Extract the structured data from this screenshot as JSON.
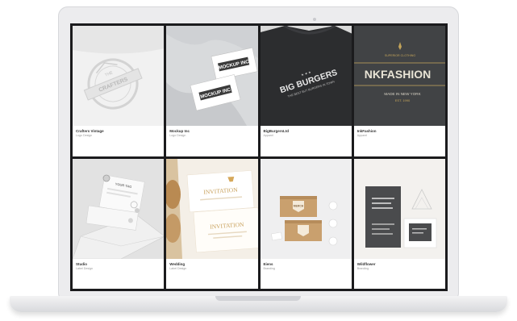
{
  "gallery": {
    "tiles": [
      {
        "title": "Crafters Vintage",
        "subtitle": "Logo Design",
        "art": {
          "seal_top": "THE",
          "seal_text": "CRAFTERS",
          "bg": "#f1f1f1"
        }
      },
      {
        "title": "Mockup Inc",
        "subtitle": "Logo Design",
        "art": {
          "card_text": "MOCKUP INC",
          "bg": "#d8dadc"
        }
      },
      {
        "title": "BigBurgersLtd",
        "subtitle": "Apparel",
        "art": {
          "line1": "BIG BURGERS",
          "line2": "THE BEST BUT BURGERS IN TOWN",
          "bg": "#2c2d2f"
        }
      },
      {
        "title": "InkFashion",
        "subtitle": "Apparel",
        "art": {
          "brand": "NKFASHION",
          "tag": "SUPERIOR CLOTHING",
          "made": "MADE IN NEW YORK",
          "est": "EST. 1990",
          "bg": "#454648"
        }
      },
      {
        "title": "Studio",
        "subtitle": "Label Design",
        "art": {
          "label": "YOUR TAG",
          "bg": "#e2e2e2"
        }
      },
      {
        "title": "Wedding",
        "subtitle": "Label Design",
        "art": {
          "word1": "INVITATION",
          "word2": "INVITATION",
          "bg": "#f4efe7"
        }
      },
      {
        "title": "Eiens",
        "subtitle": "Branding",
        "art": {
          "badge": "MERCH",
          "bg": "#efeff0"
        }
      },
      {
        "title": "Wildflower",
        "subtitle": "Branding",
        "art": {
          "bg": "#f3f1ee"
        }
      }
    ]
  }
}
